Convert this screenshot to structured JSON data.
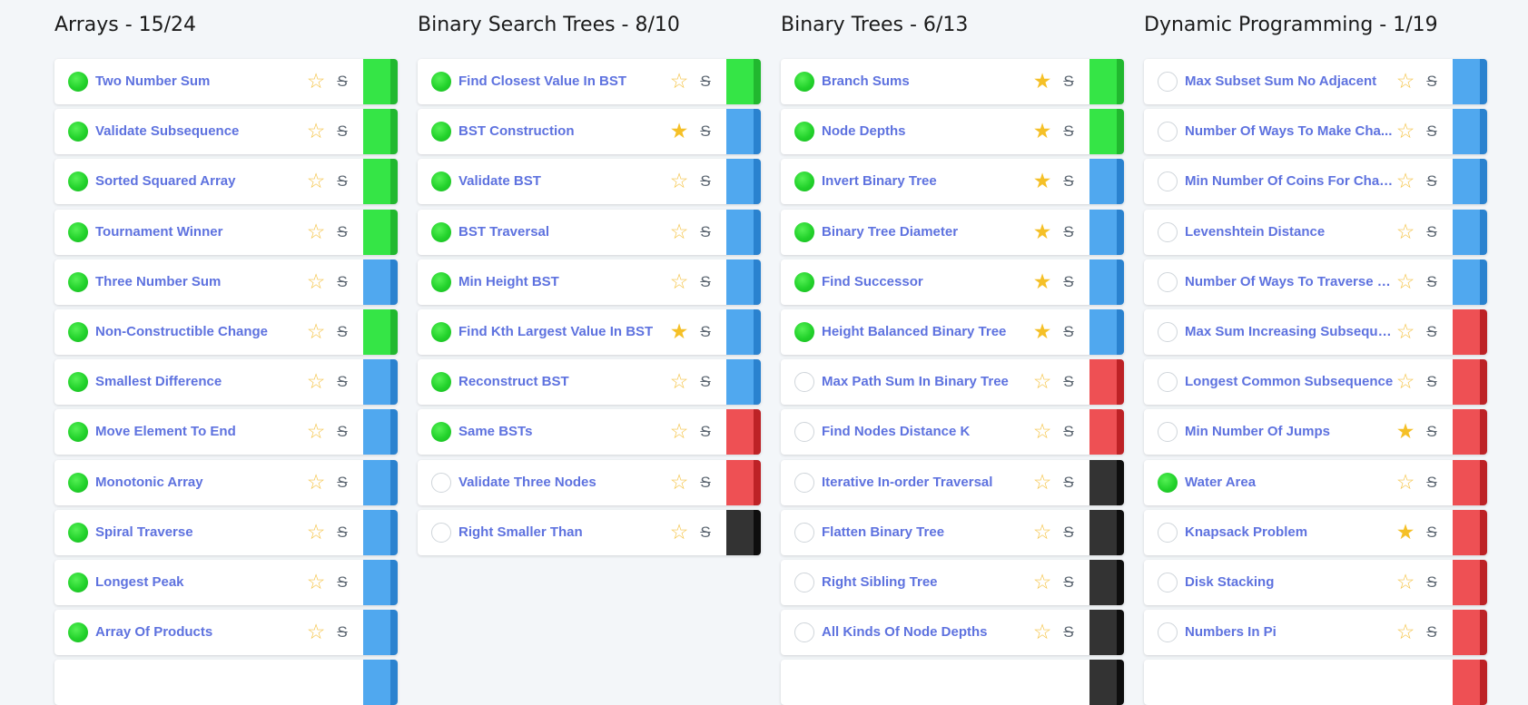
{
  "colors": {
    "background": "#f3f6f9",
    "title": "#1b1b1b",
    "link": "#5e72df",
    "completed": "#22d22b",
    "star": "#f5c027",
    "easy": "#36e446",
    "medium": "#4ea6ee",
    "hard": "#ed4f52",
    "very_hard": "#333333"
  },
  "icons": {
    "star_outline": "☆",
    "star_filled": "★",
    "strikethrough": "S"
  },
  "difficulty_colors": {
    "easy": [
      "#35e546",
      "#21b82f"
    ],
    "medium": [
      "#50a8ef",
      "#2a82cf"
    ],
    "hard": [
      "#ee5054",
      "#bd2226"
    ],
    "very_hard": [
      "#333333",
      "#0e0e0e"
    ]
  },
  "columns": [
    {
      "title": "Arrays - 15/24",
      "items": [
        {
          "name": "Two Number Sum",
          "completed": true,
          "starred": false,
          "difficulty": "easy"
        },
        {
          "name": "Validate Subsequence",
          "completed": true,
          "starred": false,
          "difficulty": "easy"
        },
        {
          "name": "Sorted Squared Array",
          "completed": true,
          "starred": false,
          "difficulty": "easy"
        },
        {
          "name": "Tournament Winner",
          "completed": true,
          "starred": false,
          "difficulty": "easy"
        },
        {
          "name": "Three Number Sum",
          "completed": true,
          "starred": false,
          "difficulty": "medium"
        },
        {
          "name": "Non-Constructible Change",
          "completed": true,
          "starred": false,
          "difficulty": "easy"
        },
        {
          "name": "Smallest Difference",
          "completed": true,
          "starred": false,
          "difficulty": "medium"
        },
        {
          "name": "Move Element To End",
          "completed": true,
          "starred": false,
          "difficulty": "medium"
        },
        {
          "name": "Monotonic Array",
          "completed": true,
          "starred": false,
          "difficulty": "medium"
        },
        {
          "name": "Spiral Traverse",
          "completed": true,
          "starred": false,
          "difficulty": "medium"
        },
        {
          "name": "Longest Peak",
          "completed": true,
          "starred": false,
          "difficulty": "medium"
        },
        {
          "name": "Array Of Products",
          "completed": true,
          "starred": false,
          "difficulty": "medium"
        },
        {
          "name": "",
          "completed": false,
          "starred": false,
          "difficulty": "medium",
          "partial": true
        }
      ]
    },
    {
      "title": "Binary Search Trees - 8/10",
      "items": [
        {
          "name": "Find Closest Value In BST",
          "completed": true,
          "starred": false,
          "difficulty": "easy"
        },
        {
          "name": "BST Construction",
          "completed": true,
          "starred": true,
          "difficulty": "medium"
        },
        {
          "name": "Validate BST",
          "completed": true,
          "starred": false,
          "difficulty": "medium"
        },
        {
          "name": "BST Traversal",
          "completed": true,
          "starred": false,
          "difficulty": "medium"
        },
        {
          "name": "Min Height BST",
          "completed": true,
          "starred": false,
          "difficulty": "medium"
        },
        {
          "name": "Find Kth Largest Value In BST",
          "completed": true,
          "starred": true,
          "difficulty": "medium"
        },
        {
          "name": "Reconstruct BST",
          "completed": true,
          "starred": false,
          "difficulty": "medium"
        },
        {
          "name": "Same BSTs",
          "completed": true,
          "starred": false,
          "difficulty": "hard"
        },
        {
          "name": "Validate Three Nodes",
          "completed": false,
          "starred": false,
          "difficulty": "hard"
        },
        {
          "name": "Right Smaller Than",
          "completed": false,
          "starred": false,
          "difficulty": "very_hard"
        }
      ]
    },
    {
      "title": "Binary Trees - 6/13",
      "items": [
        {
          "name": "Branch Sums",
          "completed": true,
          "starred": true,
          "difficulty": "easy"
        },
        {
          "name": "Node Depths",
          "completed": true,
          "starred": true,
          "difficulty": "easy"
        },
        {
          "name": "Invert Binary Tree",
          "completed": true,
          "starred": true,
          "difficulty": "medium"
        },
        {
          "name": "Binary Tree Diameter",
          "completed": true,
          "starred": true,
          "difficulty": "medium"
        },
        {
          "name": "Find Successor",
          "completed": true,
          "starred": true,
          "difficulty": "medium"
        },
        {
          "name": "Height Balanced Binary Tree",
          "completed": true,
          "starred": true,
          "difficulty": "medium"
        },
        {
          "name": "Max Path Sum In Binary Tree",
          "completed": false,
          "starred": false,
          "difficulty": "hard"
        },
        {
          "name": "Find Nodes Distance K",
          "completed": false,
          "starred": false,
          "difficulty": "hard"
        },
        {
          "name": "Iterative In-order Traversal",
          "completed": false,
          "starred": false,
          "difficulty": "very_hard"
        },
        {
          "name": "Flatten Binary Tree",
          "completed": false,
          "starred": false,
          "difficulty": "very_hard"
        },
        {
          "name": "Right Sibling Tree",
          "completed": false,
          "starred": false,
          "difficulty": "very_hard"
        },
        {
          "name": "All Kinds Of Node Depths",
          "completed": false,
          "starred": false,
          "difficulty": "very_hard"
        },
        {
          "name": "",
          "completed": false,
          "starred": false,
          "difficulty": "very_hard",
          "partial": true
        }
      ]
    },
    {
      "title": "Dynamic Programming - 1/19",
      "items": [
        {
          "name": "Max Subset Sum No Adjacent",
          "completed": false,
          "starred": false,
          "difficulty": "medium"
        },
        {
          "name": "Number Of Ways To Make Cha...",
          "completed": false,
          "starred": false,
          "difficulty": "medium"
        },
        {
          "name": "Min Number Of Coins For Chan...",
          "completed": false,
          "starred": false,
          "difficulty": "medium"
        },
        {
          "name": "Levenshtein Distance",
          "completed": false,
          "starred": false,
          "difficulty": "medium"
        },
        {
          "name": "Number Of Ways To Traverse G...",
          "completed": false,
          "starred": false,
          "difficulty": "medium"
        },
        {
          "name": "Max Sum Increasing Subseque...",
          "completed": false,
          "starred": false,
          "difficulty": "hard"
        },
        {
          "name": "Longest Common Subsequence",
          "completed": false,
          "starred": false,
          "difficulty": "hard"
        },
        {
          "name": "Min Number Of Jumps",
          "completed": false,
          "starred": true,
          "difficulty": "hard"
        },
        {
          "name": "Water Area",
          "completed": true,
          "starred": false,
          "difficulty": "hard"
        },
        {
          "name": "Knapsack Problem",
          "completed": false,
          "starred": true,
          "difficulty": "hard"
        },
        {
          "name": "Disk Stacking",
          "completed": false,
          "starred": false,
          "difficulty": "hard"
        },
        {
          "name": "Numbers In Pi",
          "completed": false,
          "starred": false,
          "difficulty": "hard"
        },
        {
          "name": "",
          "completed": false,
          "starred": false,
          "difficulty": "hard",
          "partial": true
        }
      ]
    }
  ]
}
